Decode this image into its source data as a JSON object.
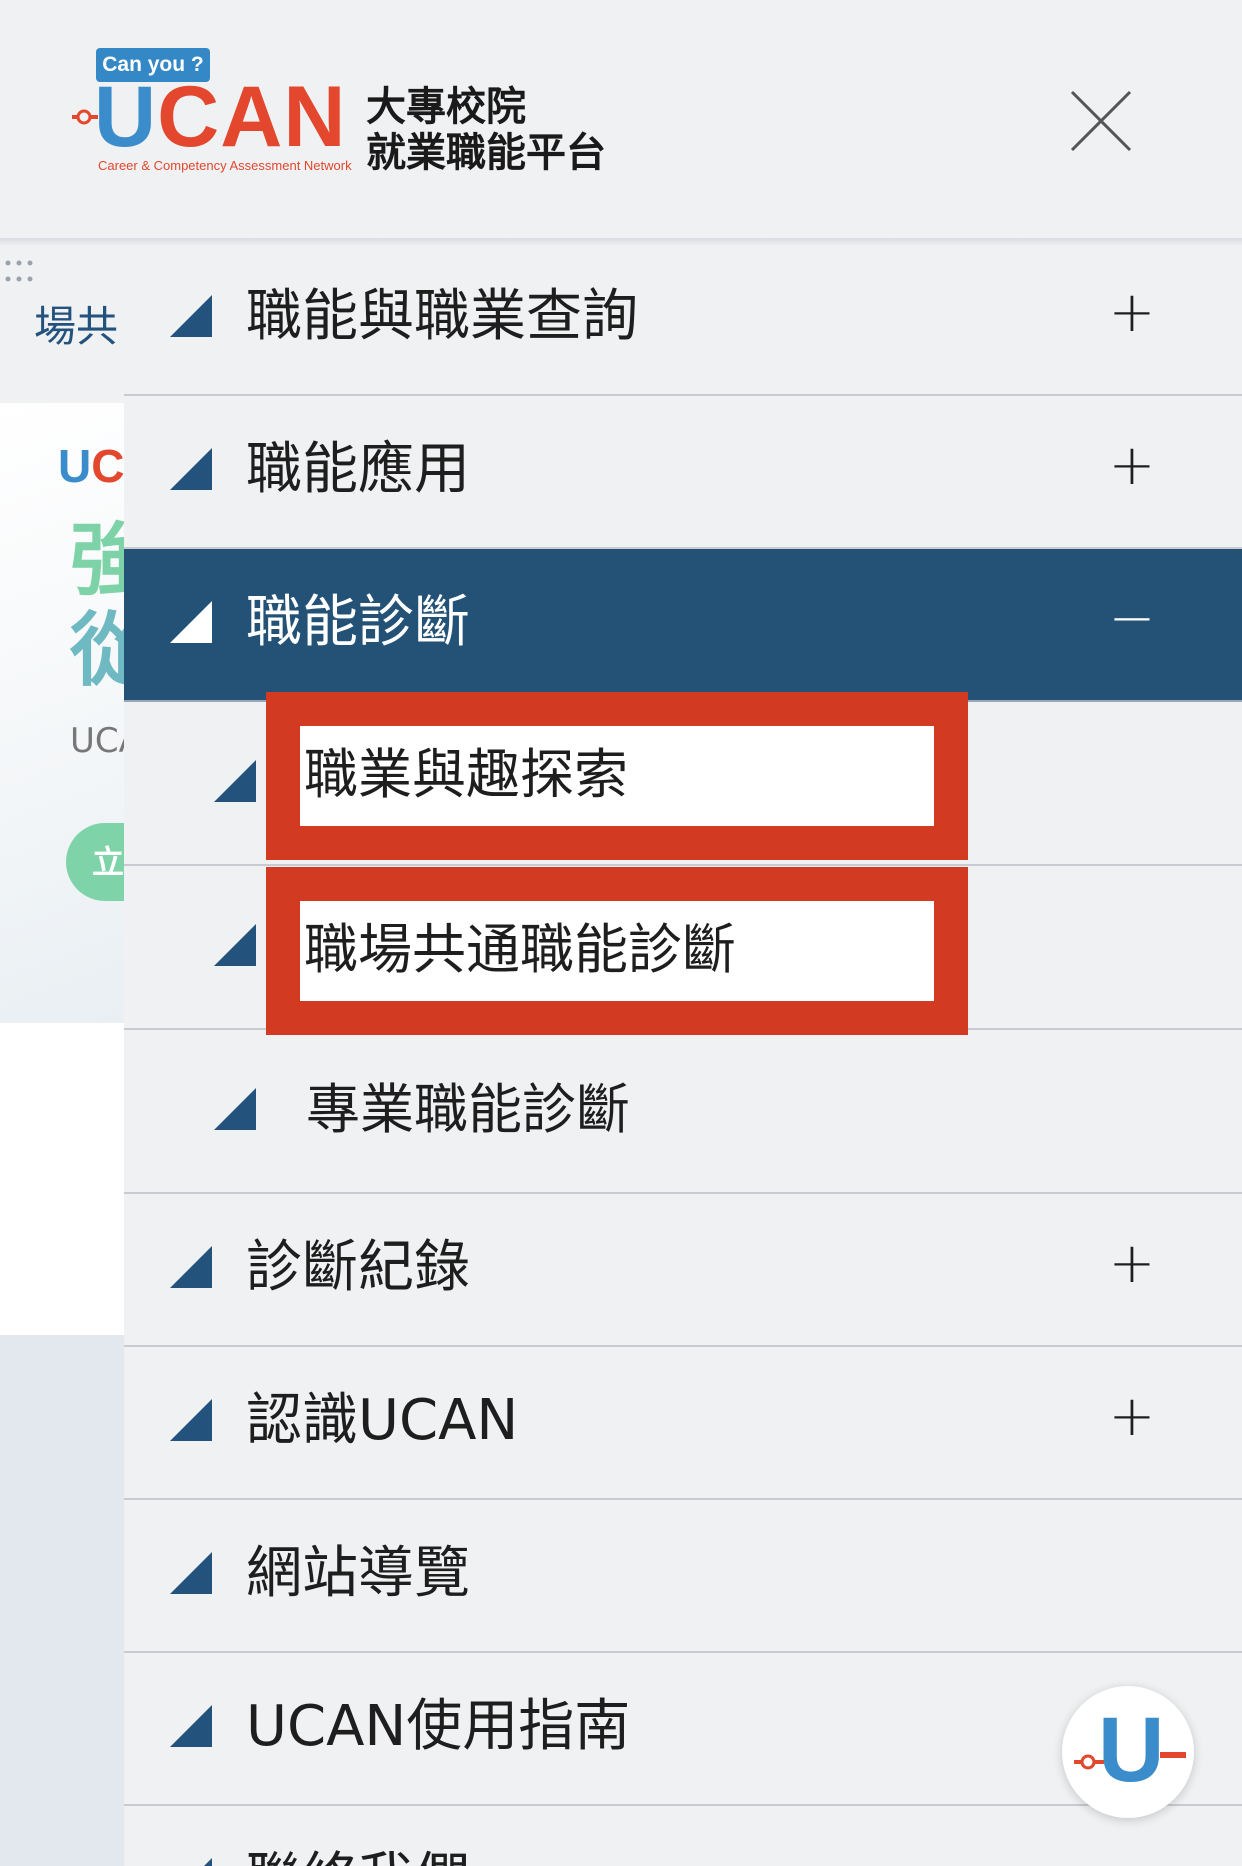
{
  "header": {
    "logo_badge": "Can you ?",
    "logo_u": "U",
    "logo_rest": "CAN",
    "logo_sub": "Career & Competency Assessment Network",
    "logo_cn_line1": "大專校院",
    "logo_cn_line2": "就業職能平台",
    "close_icon": "close-x-icon"
  },
  "background_page": {
    "breadcrumb": "場共",
    "mini_logo_u": "U",
    "mini_logo_rest": "C",
    "headline_1": "強",
    "headline_2": "從",
    "ucan_text": "UCA",
    "pill_text": "立"
  },
  "menu": {
    "items": [
      {
        "label": "職能與職業查詢",
        "sign": "+"
      },
      {
        "label": "職能應用",
        "sign": "+"
      },
      {
        "label": "職能診斷",
        "sign": "−",
        "active": true
      },
      {
        "label": "職業與趣探索",
        "sub": true,
        "highlighted": true
      },
      {
        "label": "職場共通職能診斷",
        "sub": true,
        "highlighted": true
      },
      {
        "label": "專業職能診斷",
        "sub": true
      },
      {
        "label": "診斷紀錄",
        "sign": "+"
      },
      {
        "label": "認識UCAN",
        "sign": "+"
      },
      {
        "label": "網站導覽"
      },
      {
        "label": "UCAN使用指南"
      },
      {
        "label": "聯絡我們"
      }
    ]
  },
  "fab": {
    "letter": "U"
  },
  "colors": {
    "active_bg": "#235276",
    "triangle": "#23527c",
    "highlight": "#d23a22",
    "logo_blue": "#3b8ccb",
    "logo_red": "#e3472d"
  }
}
